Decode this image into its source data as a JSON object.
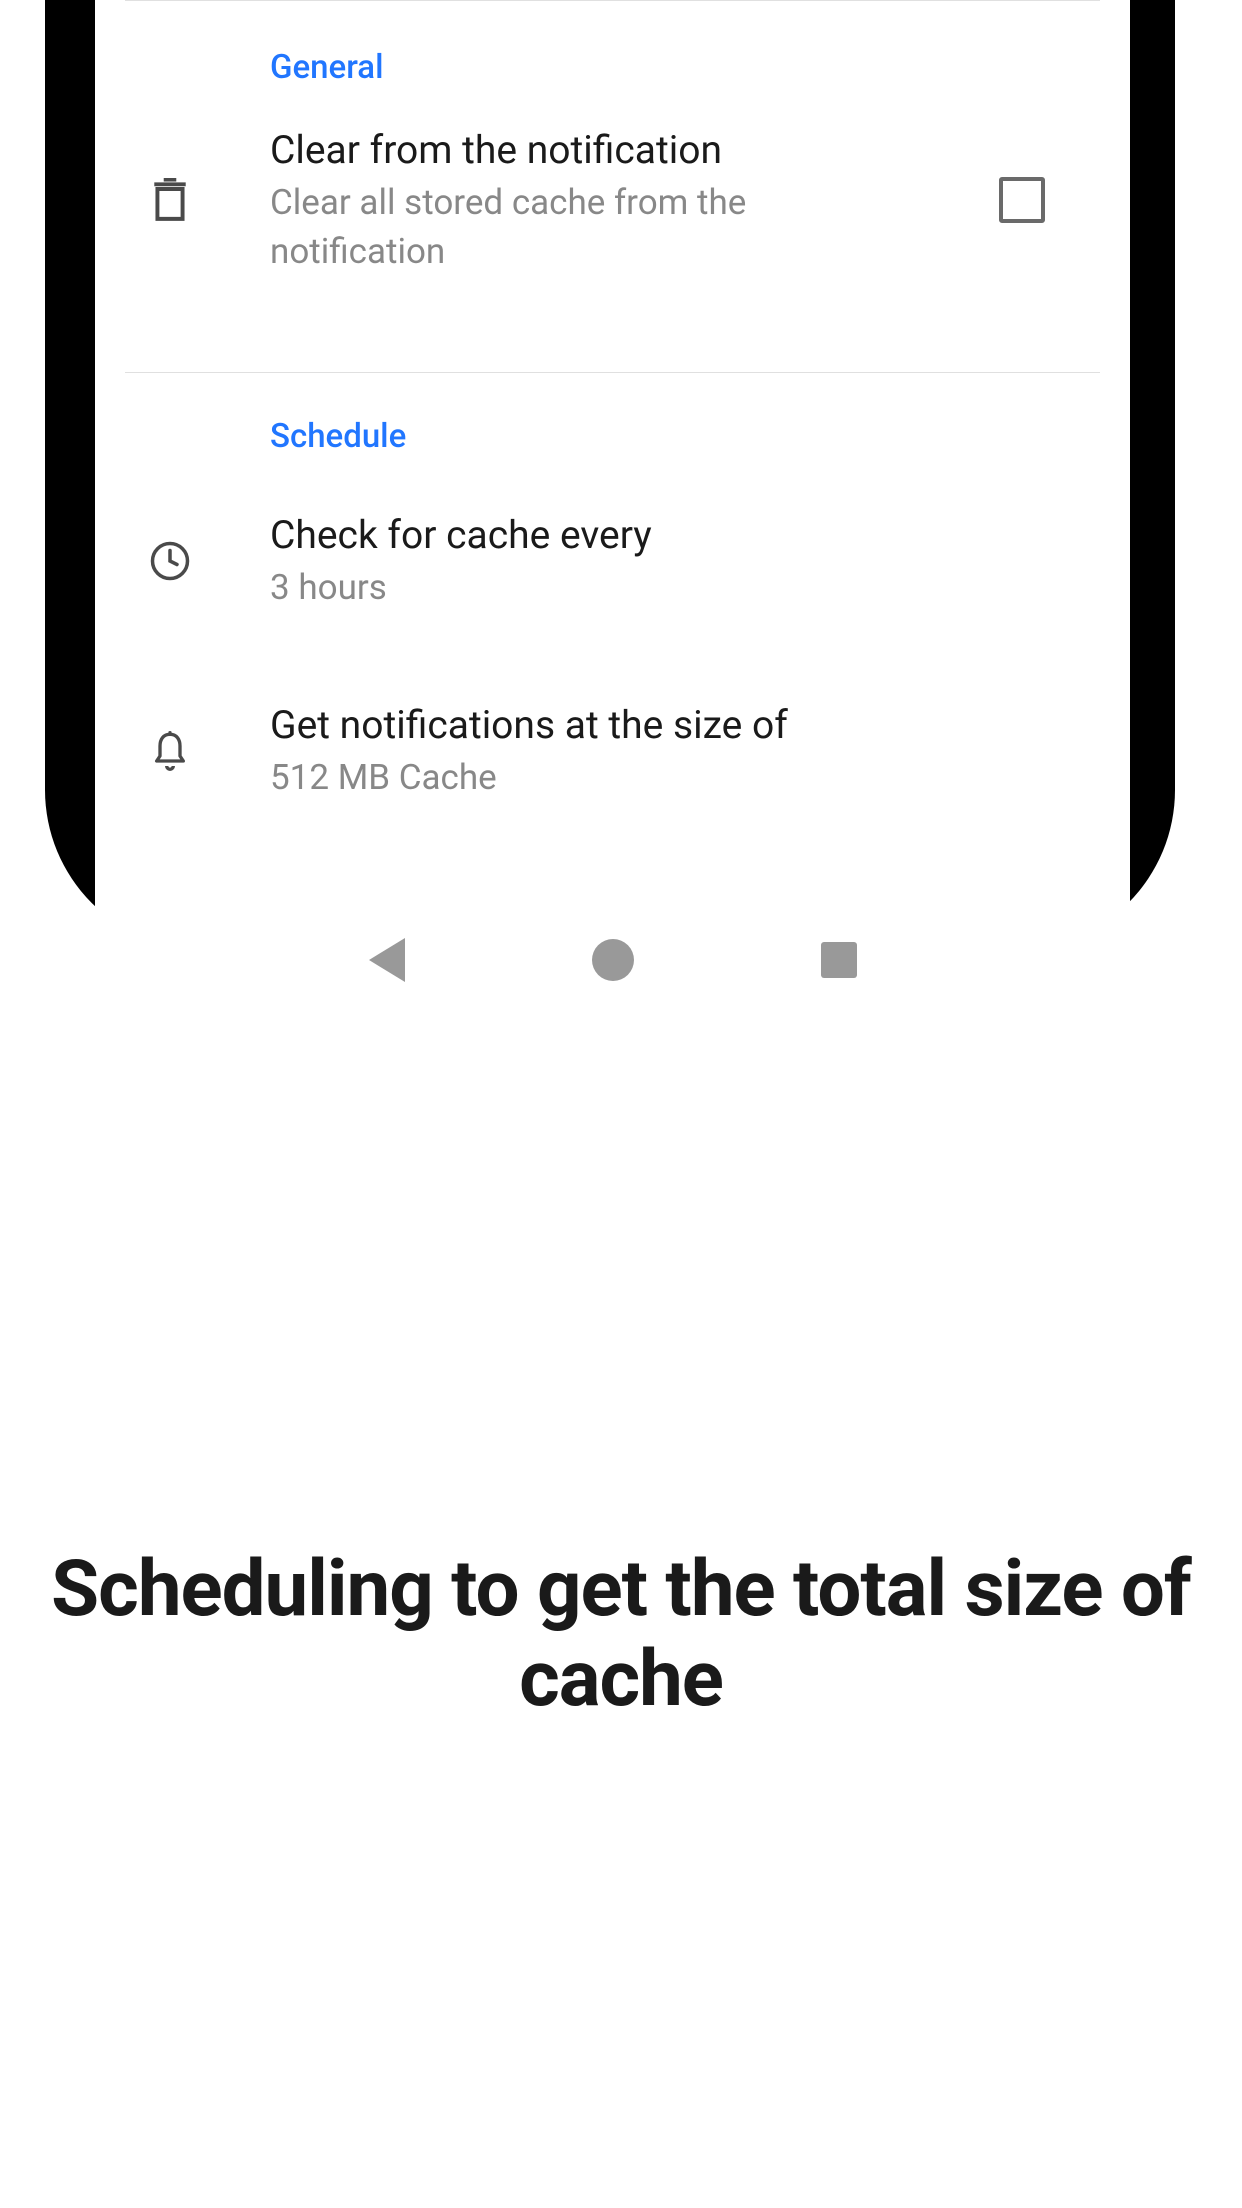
{
  "sections": {
    "general": {
      "header": "General",
      "clear": {
        "title": "Clear from the notification",
        "subtitle": "Clear all stored cache from the notification"
      }
    },
    "schedule": {
      "header": "Schedule",
      "check": {
        "title": "Check for cache every",
        "subtitle": "3 hours"
      },
      "notify": {
        "title": "Get notifications at the size of",
        "subtitle": "512 MB Cache"
      }
    }
  },
  "promo": "Scheduling to get the total size of cache"
}
